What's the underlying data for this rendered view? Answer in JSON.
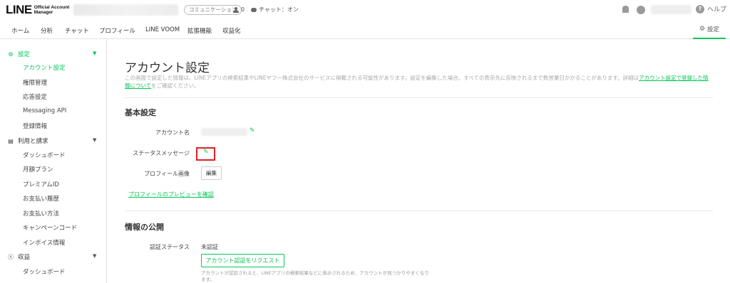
{
  "topbar": {
    "logo_text": "LINE",
    "logo_sub_1": "Official Account",
    "logo_sub_2": "Manager",
    "account_type_badge": "コミュニケーション",
    "friends_count": "0",
    "chat_status": "チャット：オン",
    "help_label": "ヘルプ"
  },
  "nav": {
    "items": [
      "ホーム",
      "分析",
      "チャット",
      "プロフィール",
      "LINE VOOM",
      "拡張機能",
      "収益化"
    ],
    "settings_label": "設定"
  },
  "sidebar": {
    "sections": [
      {
        "label": "設定",
        "active": true,
        "items": [
          "アカウント設定",
          "権限管理",
          "応答設定",
          "Messaging API",
          "登録情報"
        ]
      },
      {
        "label": "利用と請求",
        "active": false,
        "items": [
          "ダッシュボード",
          "月額プラン",
          "プレミアムID",
          "お支払い履歴",
          "お支払い方法",
          "キャンペーンコード",
          "インボイス情報"
        ]
      },
      {
        "label": "収益",
        "active": false,
        "items": [
          "ダッシュボード"
        ]
      }
    ]
  },
  "main": {
    "title": "アカウント設定",
    "description_pre": "この画面で設定した情報は、LINEアプリの検索結果やLINEヤフー株式会社のサービスに掲載される可能性があります。設定を編集した場合、すべての表示先に反映されるまで数営業日かかることがあります。詳細は",
    "description_link": "アカウント設定で登録した情報について",
    "description_post": "をご確認ください。",
    "basic_section_title": "基本設定",
    "account_name_label": "アカウント名",
    "status_message_label": "ステータスメッセージ",
    "profile_image_label": "プロフィール画像",
    "edit_button": "編集",
    "profile_preview_link": "プロフィールのプレビューを確認",
    "publish_section_title": "情報の公開",
    "verification_label": "認証ステータス",
    "verification_value": "未認証",
    "request_verification_button": "アカウント認証をリクエスト",
    "verification_note": "アカウントが認証されると、LINEアプリの検索結果などに表示されるため、アカウントが見つかりやすくなります。"
  },
  "colors": {
    "accent": "#06c755",
    "highlight": "#e02020"
  },
  "icons": [
    "bell-icon",
    "user-avatar-icon",
    "help-icon",
    "gear-icon",
    "pencil-icon",
    "person-icon",
    "chat-bubble-icon"
  ]
}
